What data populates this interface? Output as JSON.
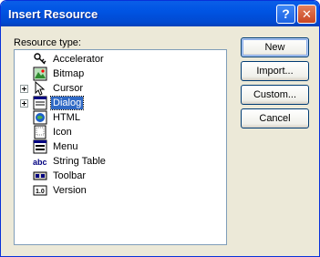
{
  "window": {
    "title": "Insert Resource"
  },
  "title_buttons": {
    "help": "?",
    "close": "✕"
  },
  "list_label": "Resource type:",
  "resources": [
    {
      "label": "Accelerator",
      "icon": "accelerator-icon",
      "expandable": false,
      "selected": false
    },
    {
      "label": "Bitmap",
      "icon": "bitmap-icon",
      "expandable": false,
      "selected": false
    },
    {
      "label": "Cursor",
      "icon": "cursor-icon",
      "expandable": true,
      "selected": false
    },
    {
      "label": "Dialog",
      "icon": "dialog-icon",
      "expandable": true,
      "selected": true
    },
    {
      "label": "HTML",
      "icon": "html-icon",
      "expandable": false,
      "selected": false
    },
    {
      "label": "Icon",
      "icon": "icon-resource-icon",
      "expandable": false,
      "selected": false
    },
    {
      "label": "Menu",
      "icon": "menu-icon",
      "expandable": false,
      "selected": false
    },
    {
      "label": "String Table",
      "icon": "string-table-icon",
      "expandable": false,
      "selected": false
    },
    {
      "label": "Toolbar",
      "icon": "toolbar-icon",
      "expandable": false,
      "selected": false
    },
    {
      "label": "Version",
      "icon": "version-icon",
      "expandable": false,
      "selected": false
    }
  ],
  "string_table_glyph": "abc",
  "version_glyph": "1.0",
  "buttons": {
    "new": "New",
    "import": "Import...",
    "custom": "Custom...",
    "cancel": "Cancel"
  }
}
